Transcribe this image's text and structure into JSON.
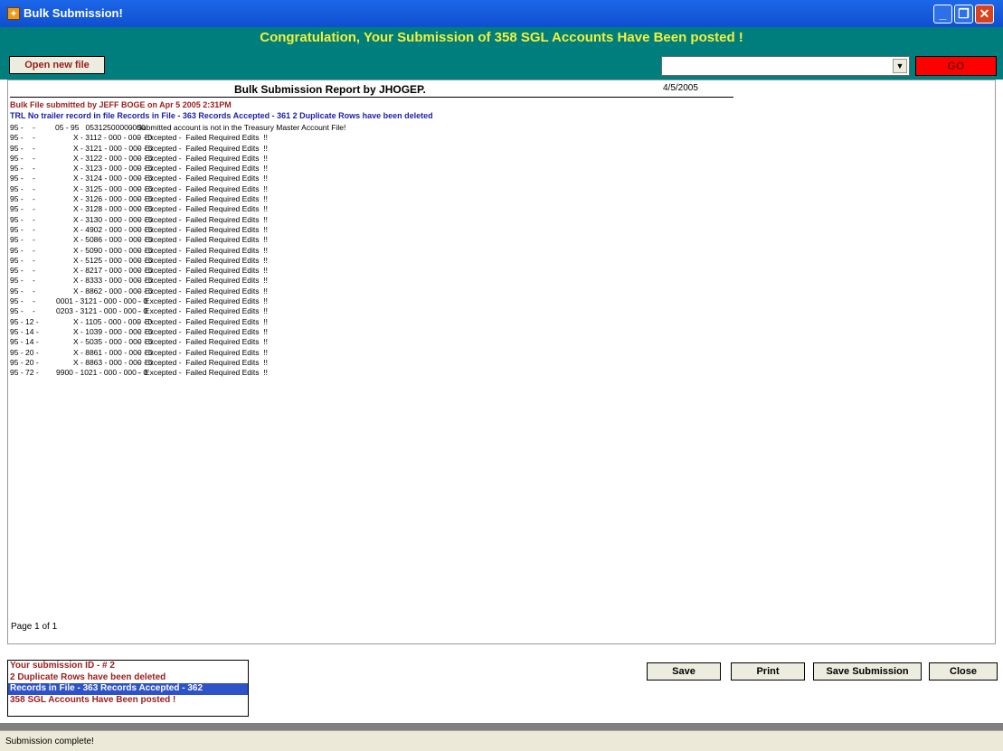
{
  "window": {
    "title": "Bulk Submission!",
    "app_icon": "app-window-icon",
    "controls": {
      "minimize": "_",
      "maximize": "❐",
      "close": "✕"
    }
  },
  "header": {
    "congrats": "Congratulation, Your Submission of 358 SGL Accounts Have Been posted !"
  },
  "toolbar": {
    "open_new_file_label": "Open new file",
    "select_value": "",
    "go_label": "GO"
  },
  "report": {
    "title": "Bulk Submission Report by JHOGEP.",
    "date": "4/5/2005",
    "submitted_line": "Bulk File submitted by   JEFF  BOGE  on  Apr  5 2005  2:31PM",
    "trl_line": "TRL No trailer record in file  Records in File - 363  Records Accepted   - 361  2 Duplicate Rows have been deleted",
    "rows": [
      {
        "a": "95 -",
        "b": "-",
        "c": "05 - 95   05312500000000",
        "d": "  -  Submitted account is not in the Treasury Master Account File!"
      },
      {
        "a": "95 -",
        "b": "-",
        "c": "X - 3112 - 000 - 000 - 0",
        "d": " -  Excepted -  Failed Required Edits  !!"
      },
      {
        "a": "95 -",
        "b": "-",
        "c": "X - 3121 - 000 - 000 - 0",
        "d": " -  Excepted -  Failed Required Edits  !!"
      },
      {
        "a": "95 -",
        "b": "-",
        "c": "X - 3122 - 000 - 000 - 0",
        "d": " -  Excepted -  Failed Required Edits  !!"
      },
      {
        "a": "95 -",
        "b": "-",
        "c": "X - 3123 - 000 - 000 - 0",
        "d": " -  Excepted -  Failed Required Edits  !!"
      },
      {
        "a": "95 -",
        "b": "-",
        "c": "X - 3124 - 000 - 000 - 0",
        "d": " -  Excepted -  Failed Required Edits  !!"
      },
      {
        "a": "95 -",
        "b": "-",
        "c": "X - 3125 - 000 - 000 - 0",
        "d": " -  Excepted -  Failed Required Edits  !!"
      },
      {
        "a": "95 -",
        "b": "-",
        "c": "X - 3126 - 000 - 000 - 0",
        "d": " -  Excepted -  Failed Required Edits  !!"
      },
      {
        "a": "95 -",
        "b": "-",
        "c": "X - 3128 - 000 - 000 - 0",
        "d": " -  Excepted -  Failed Required Edits  !!"
      },
      {
        "a": "95 -",
        "b": "-",
        "c": "X - 3130 - 000 - 000 - 0",
        "d": " -  Excepted -  Failed Required Edits  !!"
      },
      {
        "a": "95 -",
        "b": "-",
        "c": "X - 4902 - 000 - 000 - 0",
        "d": " -  Excepted -  Failed Required Edits  !!"
      },
      {
        "a": "95 -",
        "b": "-",
        "c": "X - 5086 - 000 - 000 - 0",
        "d": " -  Excepted -  Failed Required Edits  !!"
      },
      {
        "a": "95 -",
        "b": "-",
        "c": "X - 5090 - 000 - 000 - 0",
        "d": " -  Excepted -  Failed Required Edits  !!"
      },
      {
        "a": "95 -",
        "b": "-",
        "c": "X - 5125 - 000 - 000 - 0",
        "d": " -  Excepted -  Failed Required Edits  !!"
      },
      {
        "a": "95 -",
        "b": "-",
        "c": "X - 8217 - 000 - 000 - 0",
        "d": " -  Excepted -  Failed Required Edits  !!"
      },
      {
        "a": "95 -",
        "b": "-",
        "c": "X - 8333 - 000 - 000 - 0",
        "d": " -  Excepted -  Failed Required Edits  !!"
      },
      {
        "a": "95 -",
        "b": "-",
        "c": "X - 8862 - 000 - 000 - 0",
        "d": " -  Excepted -  Failed Required Edits  !!"
      },
      {
        "a": "95 -",
        "b": "-",
        "c": "0001 - 3121 - 000 - 000 - 0",
        "d": " -  Excepted -  Failed Required Edits  !!"
      },
      {
        "a": "95 -",
        "b": "-",
        "c": "0203 - 3121 - 000 - 000 - 0",
        "d": " -  Excepted -  Failed Required Edits  !!"
      },
      {
        "a": "95 - 12 -",
        "b": "",
        "c": "X - 1105 - 000 - 000 - 0",
        "d": " -  Excepted -  Failed Required Edits  !!"
      },
      {
        "a": "95 - 14 -",
        "b": "",
        "c": "X - 1039 - 000 - 000 - 0",
        "d": " -  Excepted -  Failed Required Edits  !!"
      },
      {
        "a": "95 - 14 -",
        "b": "",
        "c": "X - 5035 - 000 - 000 - 0",
        "d": " -  Excepted -  Failed Required Edits  !!"
      },
      {
        "a": "95 - 20 -",
        "b": "",
        "c": "X - 8861 - 000 - 000 - 0",
        "d": " -  Excepted -  Failed Required Edits  !!"
      },
      {
        "a": "95 - 20 -",
        "b": "",
        "c": "X - 8863 - 000 - 000 - 0",
        "d": " -  Excepted -  Failed Required Edits  !!"
      },
      {
        "a": "95 - 72 -",
        "b": "",
        "c": "9900 - 1021 - 000 - 000 - 0",
        "d": " -  Excepted -  Failed Required Edits  !!"
      }
    ],
    "page_label": "Page 1 of 1"
  },
  "summary": {
    "lines": [
      "Your submission ID - # 2",
      "2 Duplicate Rows have been deleted",
      "Records in File - 363  Records Accepted  - 362",
      "358 SGL Accounts Have Been posted !"
    ]
  },
  "actions": {
    "save": "Save",
    "print": "Print",
    "save_submission": "Save Submission",
    "close": "Close"
  },
  "status": {
    "text": "Submission complete!"
  },
  "colors": {
    "teal": "#007e7e",
    "congrats_yellow": "#f3f03a",
    "go_red": "#ff0000",
    "title_blue": "#0f4fd0"
  }
}
